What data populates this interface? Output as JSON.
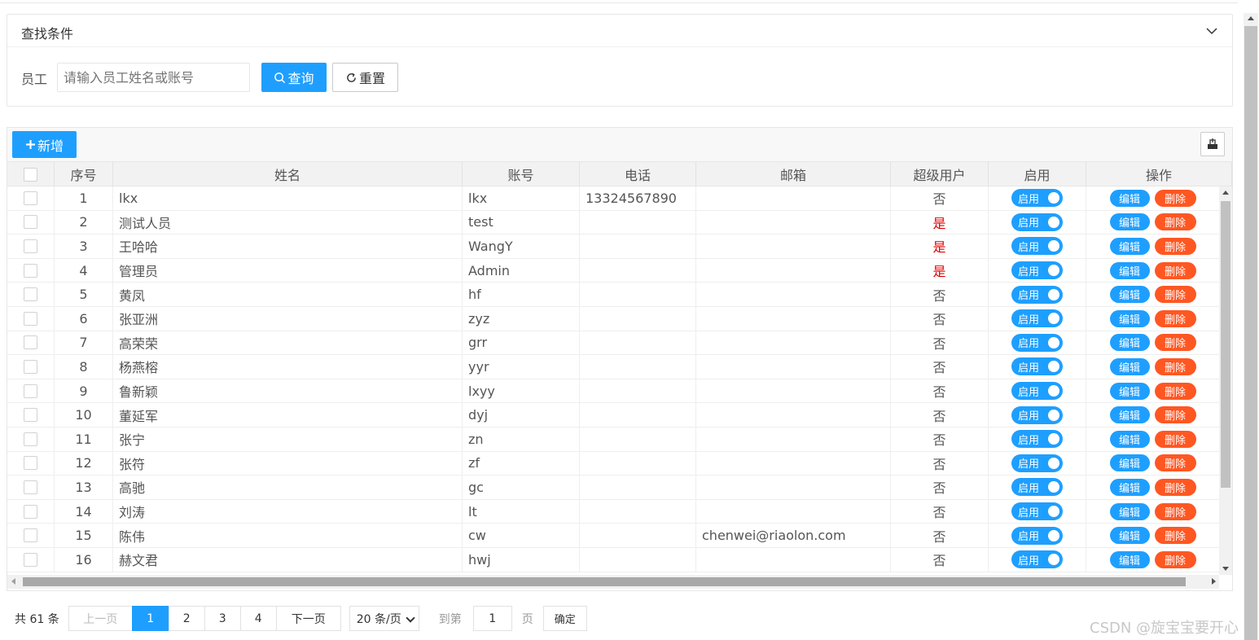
{
  "search": {
    "title": "查找条件",
    "employee_label": "员工",
    "employee_placeholder": "请输入员工姓名或账号",
    "employee_value": "",
    "query_label": "查询",
    "reset_label": "重置"
  },
  "toolbar": {
    "add_label": "新增"
  },
  "table": {
    "headers": [
      "序号",
      "姓名",
      "账号",
      "电话",
      "邮箱",
      "超级用户",
      "启用",
      "操作"
    ],
    "rows": [
      {
        "no": "1",
        "name": "lkx",
        "account": "lkx",
        "phone": "13324567890",
        "email": "",
        "super": "否",
        "enabled": "启用"
      },
      {
        "no": "2",
        "name": "测试人员",
        "account": "test",
        "phone": "",
        "email": "",
        "super": "是",
        "enabled": "启用"
      },
      {
        "no": "3",
        "name": "王哈哈",
        "account": "WangY",
        "phone": "",
        "email": "",
        "super": "是",
        "enabled": "启用"
      },
      {
        "no": "4",
        "name": "管理员",
        "account": "Admin",
        "phone": "",
        "email": "",
        "super": "是",
        "enabled": "启用"
      },
      {
        "no": "5",
        "name": "黄凤",
        "account": "hf",
        "phone": "",
        "email": "",
        "super": "否",
        "enabled": "启用"
      },
      {
        "no": "6",
        "name": "张亚洲",
        "account": "zyz",
        "phone": "",
        "email": "",
        "super": "否",
        "enabled": "启用"
      },
      {
        "no": "7",
        "name": "高荣荣",
        "account": "grr",
        "phone": "",
        "email": "",
        "super": "否",
        "enabled": "启用"
      },
      {
        "no": "8",
        "name": "杨燕榕",
        "account": "yyr",
        "phone": "",
        "email": "",
        "super": "否",
        "enabled": "启用"
      },
      {
        "no": "9",
        "name": "鲁新颖",
        "account": "lxyy",
        "phone": "",
        "email": "",
        "super": "否",
        "enabled": "启用"
      },
      {
        "no": "10",
        "name": "董延军",
        "account": "dyj",
        "phone": "",
        "email": "",
        "super": "否",
        "enabled": "启用"
      },
      {
        "no": "11",
        "name": "张宁",
        "account": "zn",
        "phone": "",
        "email": "",
        "super": "否",
        "enabled": "启用"
      },
      {
        "no": "12",
        "name": "张符",
        "account": "zf",
        "phone": "",
        "email": "",
        "super": "否",
        "enabled": "启用"
      },
      {
        "no": "13",
        "name": "高驰",
        "account": "gc",
        "phone": "",
        "email": "",
        "super": "否",
        "enabled": "启用"
      },
      {
        "no": "14",
        "name": "刘涛",
        "account": "lt",
        "phone": "",
        "email": "",
        "super": "否",
        "enabled": "启用"
      },
      {
        "no": "15",
        "name": "陈伟",
        "account": "cw",
        "phone": "",
        "email": "chenwei@riaolon.com",
        "super": "否",
        "enabled": "启用"
      },
      {
        "no": "16",
        "name": "赫文君",
        "account": "hwj",
        "phone": "",
        "email": "",
        "super": "否",
        "enabled": "启用"
      }
    ],
    "edit_label": "编辑",
    "delete_label": "删除"
  },
  "pagination": {
    "total": "共 61 条",
    "prev": "上一页",
    "pages": [
      "1",
      "2",
      "3",
      "4"
    ],
    "current": "1",
    "next": "下一页",
    "page_size": "20 条/页",
    "goto_label": "到第",
    "goto_value": "1",
    "page_unit": "页",
    "confirm": "确定"
  },
  "watermark": "CSDN @旋宝宝要开心",
  "colors": {
    "primary": "#1e9fff",
    "danger": "#ff5722",
    "super_yes": "#e00000"
  }
}
